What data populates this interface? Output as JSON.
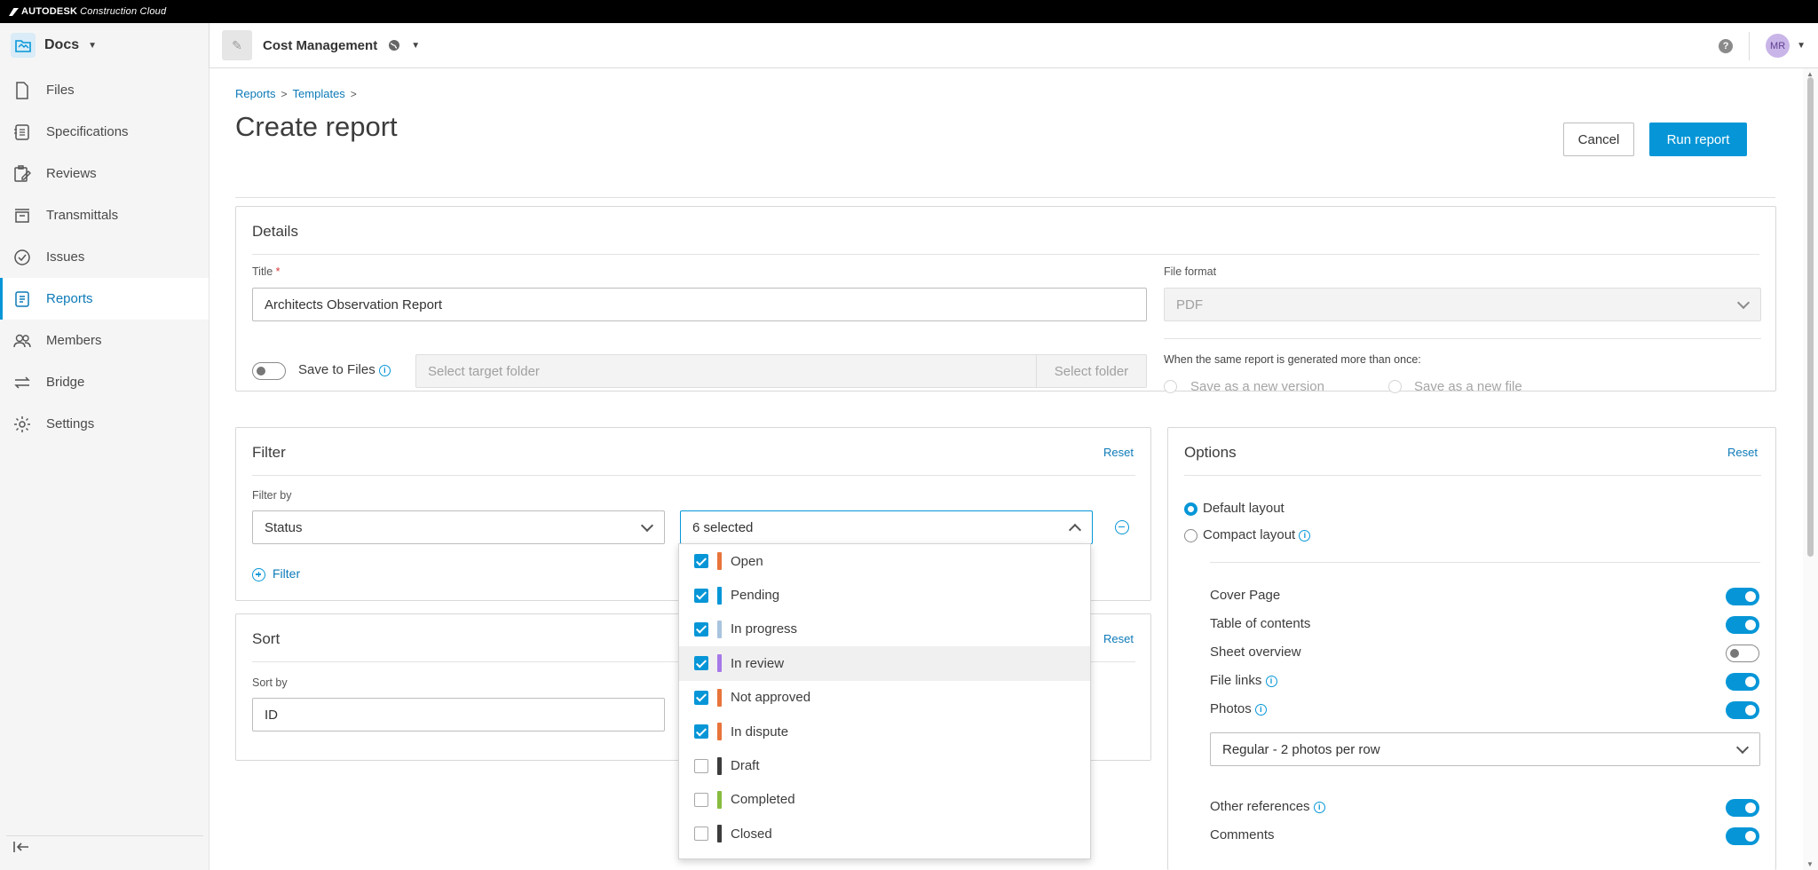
{
  "brand": {
    "autodesk": "AUTODESK",
    "product": "Construction Cloud"
  },
  "header": {
    "module": "Docs",
    "project": "Cost Management",
    "user_initials": "MR"
  },
  "sidebar": {
    "items": [
      {
        "label": "Files",
        "icon": "file-icon"
      },
      {
        "label": "Specifications",
        "icon": "specifications-icon"
      },
      {
        "label": "Reviews",
        "icon": "reviews-icon"
      },
      {
        "label": "Transmittals",
        "icon": "transmittals-icon"
      },
      {
        "label": "Issues",
        "icon": "issues-icon"
      },
      {
        "label": "Reports",
        "icon": "reports-icon",
        "active": true
      },
      {
        "label": "Members",
        "icon": "members-icon"
      },
      {
        "label": "Bridge",
        "icon": "bridge-icon"
      },
      {
        "label": "Settings",
        "icon": "settings-icon"
      }
    ]
  },
  "breadcrumb": {
    "reports": "Reports",
    "templates": "Templates",
    "sep": ">"
  },
  "page": {
    "title": "Create report",
    "cancel": "Cancel",
    "run": "Run report"
  },
  "details": {
    "heading": "Details",
    "title_label": "Title",
    "title_required": "*",
    "title_value": "Architects Observation Report",
    "format_label": "File format",
    "format_value": "PDF",
    "save_label": "Save to Files",
    "save_enabled": false,
    "folder_placeholder": "Select target folder",
    "folder_button": "Select folder",
    "regen_label": "When the same report is generated more than once:",
    "regen_options": [
      "Save as a new version",
      "Save as a new file"
    ]
  },
  "filter": {
    "heading": "Filter",
    "reset": "Reset",
    "by_label": "Filter by",
    "field": "Status",
    "selected": "6 selected",
    "add": "Filter",
    "options": [
      {
        "label": "Open",
        "checked": true,
        "color": "#e8743b"
      },
      {
        "label": "Pending",
        "checked": true,
        "color": "#0696d7"
      },
      {
        "label": "In progress",
        "checked": true,
        "color": "#a9c4de"
      },
      {
        "label": "In review",
        "checked": true,
        "color": "#a678e8"
      },
      {
        "label": "Not approved",
        "checked": true,
        "color": "#e8743b"
      },
      {
        "label": "In dispute",
        "checked": true,
        "color": "#e8743b"
      },
      {
        "label": "Draft",
        "checked": false,
        "color": "#3c3c3c"
      },
      {
        "label": "Completed",
        "checked": false,
        "color": "#87bc40"
      },
      {
        "label": "Closed",
        "checked": false,
        "color": "#3c3c3c"
      }
    ]
  },
  "sort": {
    "heading": "Sort",
    "reset": "Reset",
    "by_label": "Sort by",
    "value": "ID"
  },
  "options": {
    "heading": "Options",
    "reset": "Reset",
    "layouts": [
      "Default layout",
      "Compact layout"
    ],
    "toggles": [
      {
        "label": "Cover Page",
        "on": true
      },
      {
        "label": "Table of contents",
        "on": true
      },
      {
        "label": "Sheet overview",
        "on": false
      },
      {
        "label": "File links",
        "on": true,
        "info": true
      },
      {
        "label": "Photos",
        "on": true,
        "info": true
      }
    ],
    "photos_layout": "Regular - 2 photos per row",
    "toggles2": [
      {
        "label": "Other references",
        "on": true,
        "info": true
      },
      {
        "label": "Comments",
        "on": true
      }
    ]
  },
  "colors": {
    "accent": "#0696d7",
    "link": "#0d7ab8"
  }
}
